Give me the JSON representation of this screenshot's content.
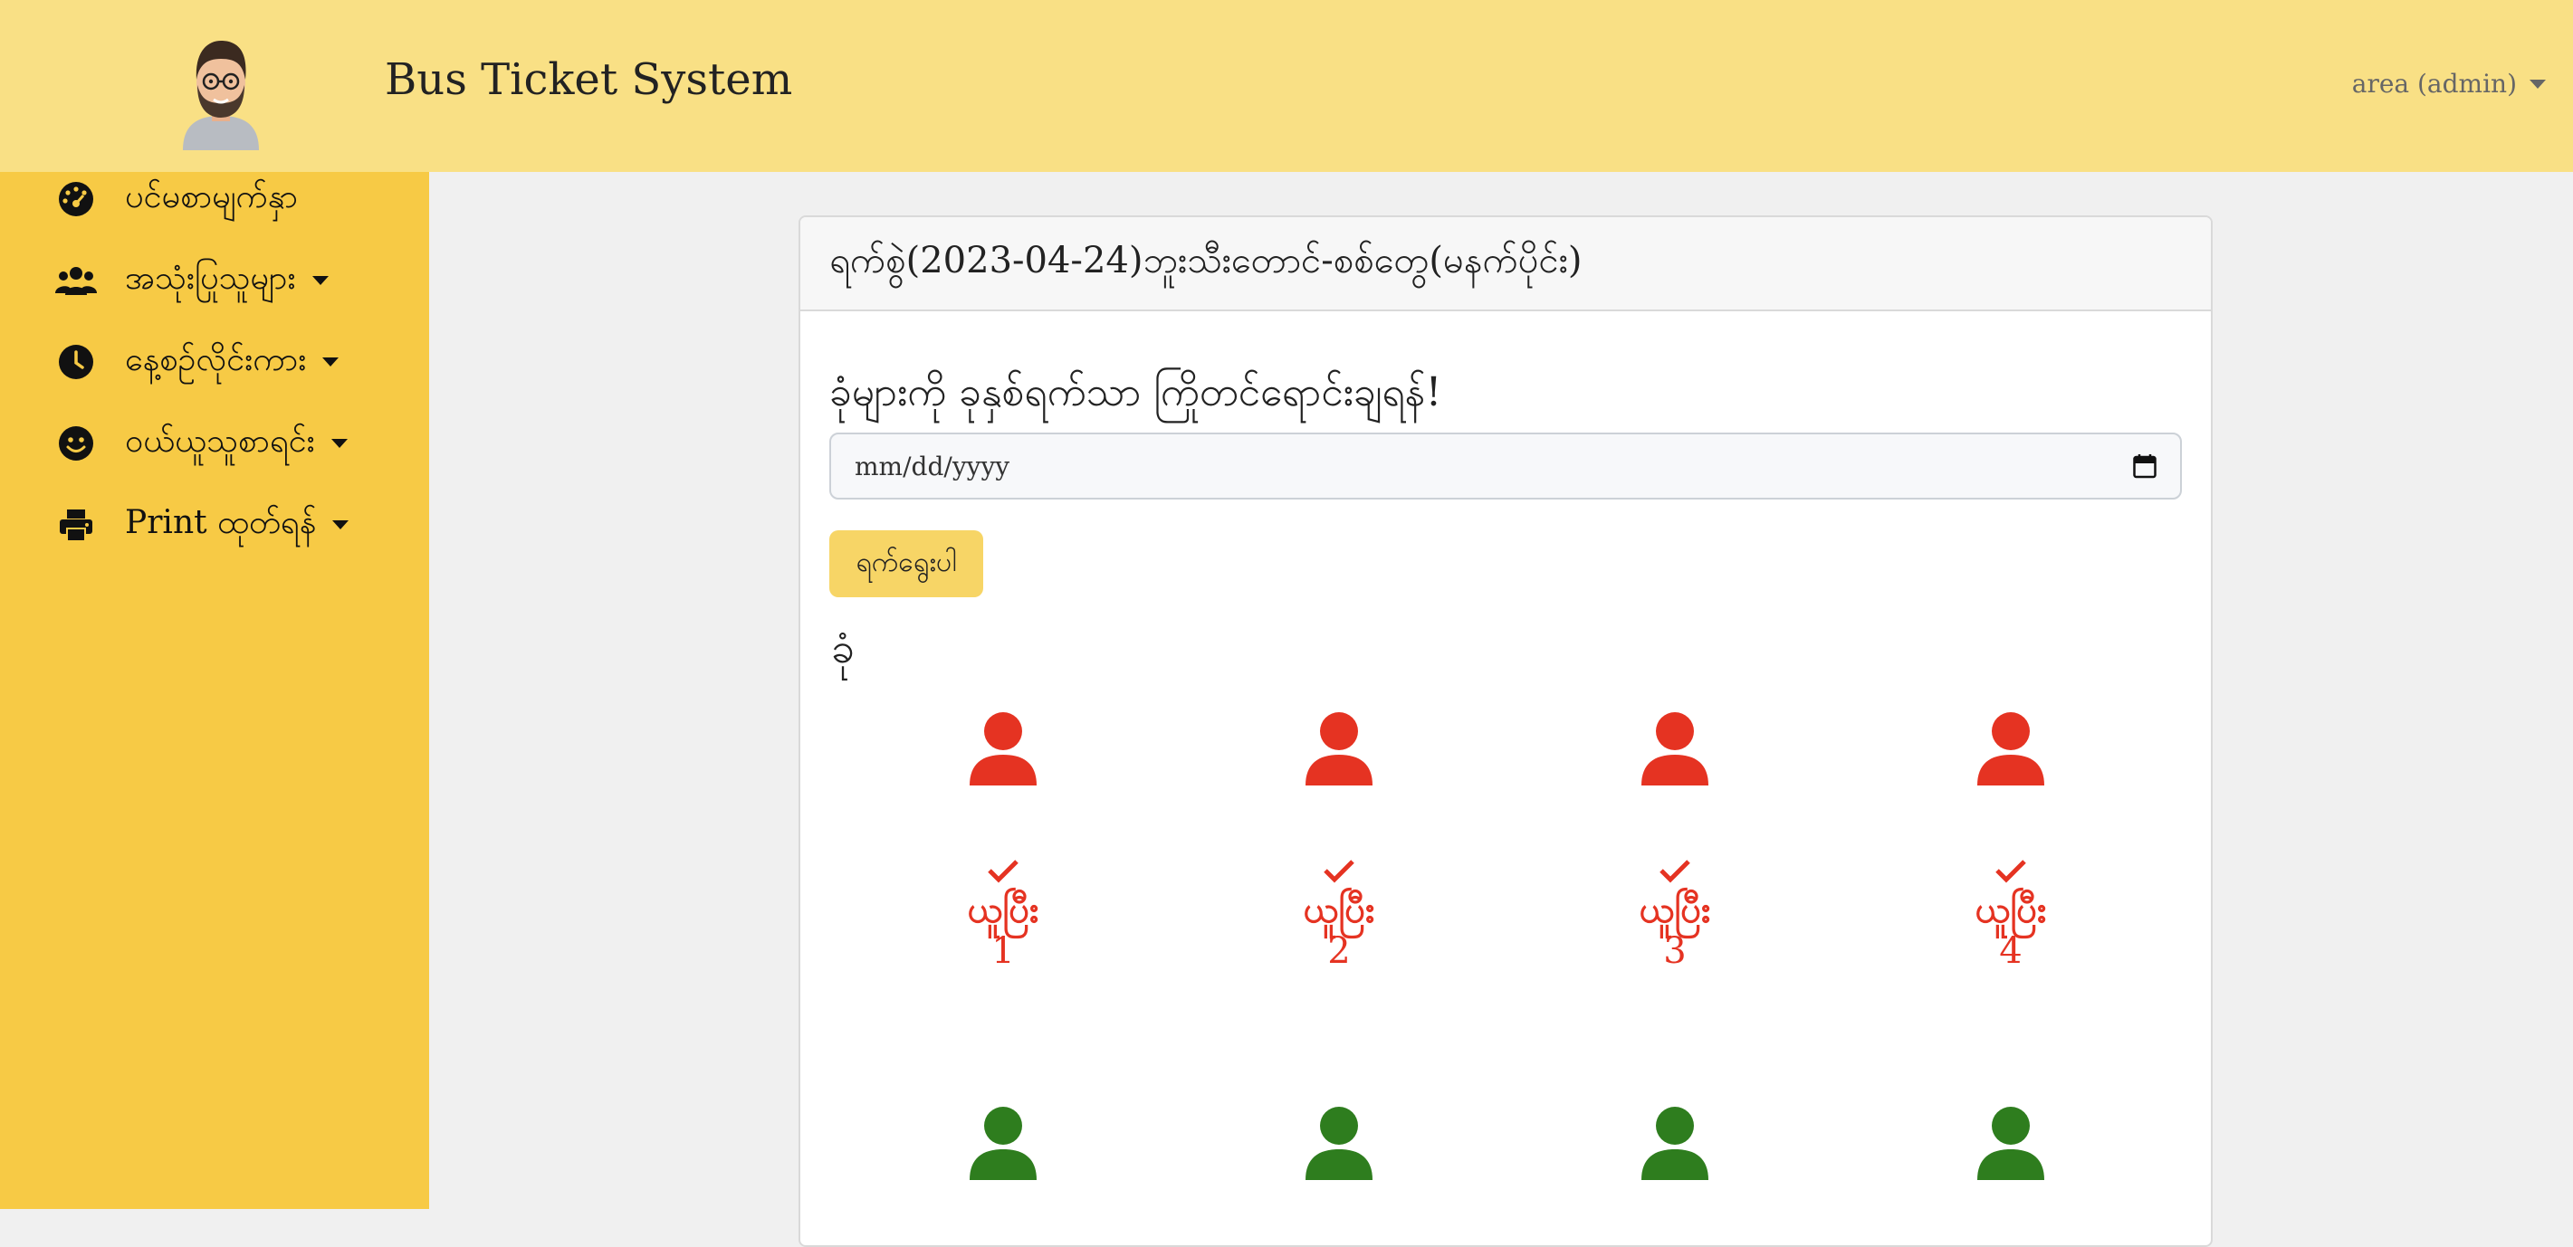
{
  "header": {
    "brand": "Bus Ticket System",
    "user_menu": "area (admin)"
  },
  "sidebar": {
    "items": [
      {
        "label": "ပင်မစာမျက်နှာ",
        "icon": "dashboard-icon",
        "has_dropdown": false
      },
      {
        "label": "အသုံးပြုသူများ",
        "icon": "users-icon",
        "has_dropdown": true
      },
      {
        "label": "နေ့စဉ်လိုင်းကား",
        "icon": "clock-icon",
        "has_dropdown": true
      },
      {
        "label": "ဝယ်ယူသူစာရင်း",
        "icon": "smile-icon",
        "has_dropdown": true
      },
      {
        "label": "Print ထုတ်ရန်",
        "icon": "print-icon",
        "has_dropdown": true
      }
    ]
  },
  "card": {
    "title": "ရက်စွဲ(2023-04-24)ဘူးသီးတောင်-စစ်တွေ(မနက်ပိုင်း)",
    "prompt": "ခုံများကို ခုနှစ်ရက်သာ ကြိုတင်ရောင်းချရန်!",
    "date_input": {
      "placeholder": "mm/dd/yyyy",
      "icon": "calendar-icon"
    },
    "submit_label": "ရက်ရွေးပါ",
    "seats_heading": "ခုံ"
  },
  "seats": [
    {
      "number": "1",
      "status": "ယူပြီး",
      "taken": true
    },
    {
      "number": "2",
      "status": "ယူပြီး",
      "taken": true
    },
    {
      "number": "3",
      "status": "ယူပြီး",
      "taken": true
    },
    {
      "number": "4",
      "status": "ယူပြီး",
      "taken": true
    },
    {
      "number": "",
      "status": "",
      "taken": false
    },
    {
      "number": "",
      "status": "",
      "taken": false
    },
    {
      "number": "",
      "status": "",
      "taken": false
    },
    {
      "number": "",
      "status": "",
      "taken": false
    }
  ],
  "colors": {
    "header_bg": "#f9e085",
    "sidebar_bg": "#f7ca45",
    "taken": "#e53322",
    "available": "#2e7d1e",
    "button_bg": "#f7d566"
  }
}
